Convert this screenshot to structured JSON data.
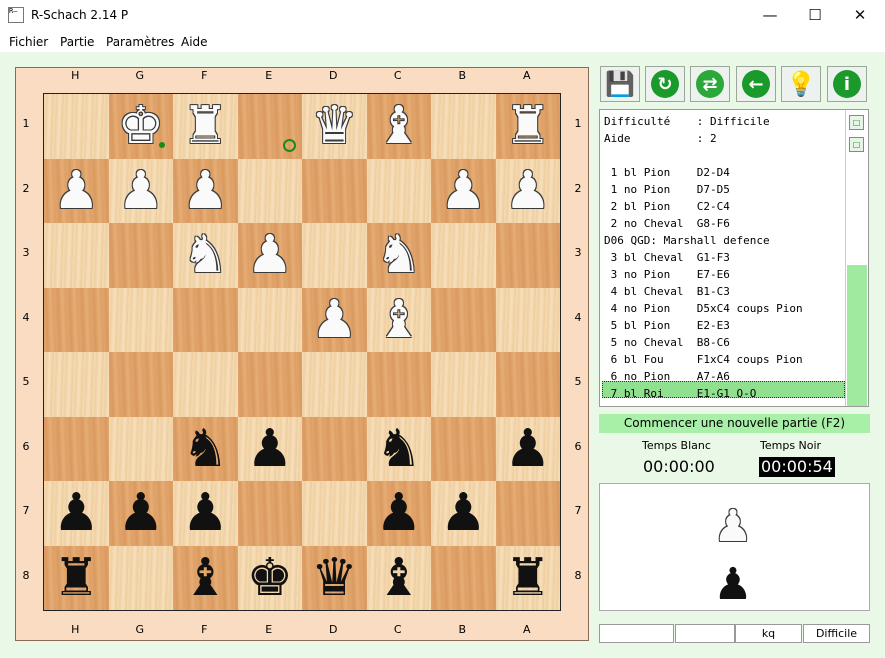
{
  "window": {
    "title": "R-Schach 2.14 P",
    "icon_text": "R—",
    "minimize": "—",
    "maximize": "☐",
    "close": "✕"
  },
  "menu": [
    "Fichier",
    "Partie",
    "Paramètres",
    "Aide"
  ],
  "board": {
    "files": [
      "H",
      "G",
      "F",
      "E",
      "D",
      "C",
      "B",
      "A"
    ],
    "ranks": [
      "1",
      "2",
      "3",
      "4",
      "5",
      "6",
      "7",
      "8"
    ],
    "rows": [
      [
        "",
        "WK",
        "WR",
        "",
        "WQ",
        "WB",
        "",
        "WR"
      ],
      [
        "WP",
        "WP",
        "WP",
        "",
        "",
        "",
        "WP",
        "WP"
      ],
      [
        "",
        "",
        "WN",
        "WP",
        "",
        "WN",
        "",
        ""
      ],
      [
        "",
        "",
        "",
        "",
        "WP",
        "WB",
        "",
        ""
      ],
      [
        "",
        "",
        "",
        "",
        "",
        "",
        "",
        ""
      ],
      [
        "",
        "",
        "BN",
        "BP",
        "",
        "BN",
        "",
        "BP"
      ],
      [
        "BP",
        "BP",
        "BP",
        "",
        "",
        "BP",
        "BP",
        ""
      ],
      [
        "BR",
        "",
        "BB",
        "BK",
        "BQ",
        "BB",
        "",
        "BR"
      ]
    ],
    "glyphs": {
      "K": "♚",
      "Q": "♛",
      "R": "♜",
      "B": "♝",
      "N": "♞",
      "P": "♟"
    }
  },
  "toolbar": [
    {
      "name": "save-game-button",
      "icon": "floppy-disk-icon",
      "glyph": "💾",
      "color": "#333333"
    },
    {
      "name": "new-game-button",
      "icon": "refresh-icon",
      "glyph": "↻",
      "color": "#1a9a2a"
    },
    {
      "name": "swap-sides-button",
      "icon": "sync-icon",
      "glyph": "⇄",
      "color": "#2aa83a"
    },
    {
      "name": "undo-move-button",
      "icon": "arrow-left-icon",
      "glyph": "←",
      "color": "#1a9a2a"
    },
    {
      "name": "hint-button",
      "icon": "lightbulb-icon",
      "glyph": "💡",
      "color": "#f0e070"
    },
    {
      "name": "info-button",
      "icon": "info-icon",
      "glyph": "i",
      "color": "#1a9a2a"
    }
  ],
  "movelist": {
    "lines": [
      "Difficulté    : Difficile",
      "Aide          : 2",
      "",
      " 1 bl Pion    D2-D4",
      " 1 no Pion    D7-D5",
      " 2 bl Pion    C2-C4",
      " 2 no Cheval  G8-F6",
      "D06 QGD: Marshall defence",
      " 3 bl Cheval  G1-F3",
      " 3 no Pion    E7-E6",
      " 4 bl Cheval  B1-C3",
      " 4 no Pion    D5xC4 coups Pion",
      " 5 bl Pion    E2-E3",
      " 5 no Cheval  B8-C6",
      " 6 bl Fou     F1xC4 coups Pion",
      " 6 no Pion    A7-A6",
      " 7 bl Roi     E1-G1 O-O"
    ],
    "highlighted_index": 16
  },
  "new_game_label": "Commencer une nouvelle partie (F2)",
  "clock": {
    "white_label": "Temps Blanc",
    "black_label": "Temps Noir",
    "white_time": "00:00:00",
    "black_time": "00:00:54"
  },
  "status": [
    "",
    "",
    "kq",
    "Difficile"
  ],
  "colors": {
    "background": "#eaf8e8",
    "accent_green": "#a8f0a8",
    "highlight": "#90e090"
  }
}
